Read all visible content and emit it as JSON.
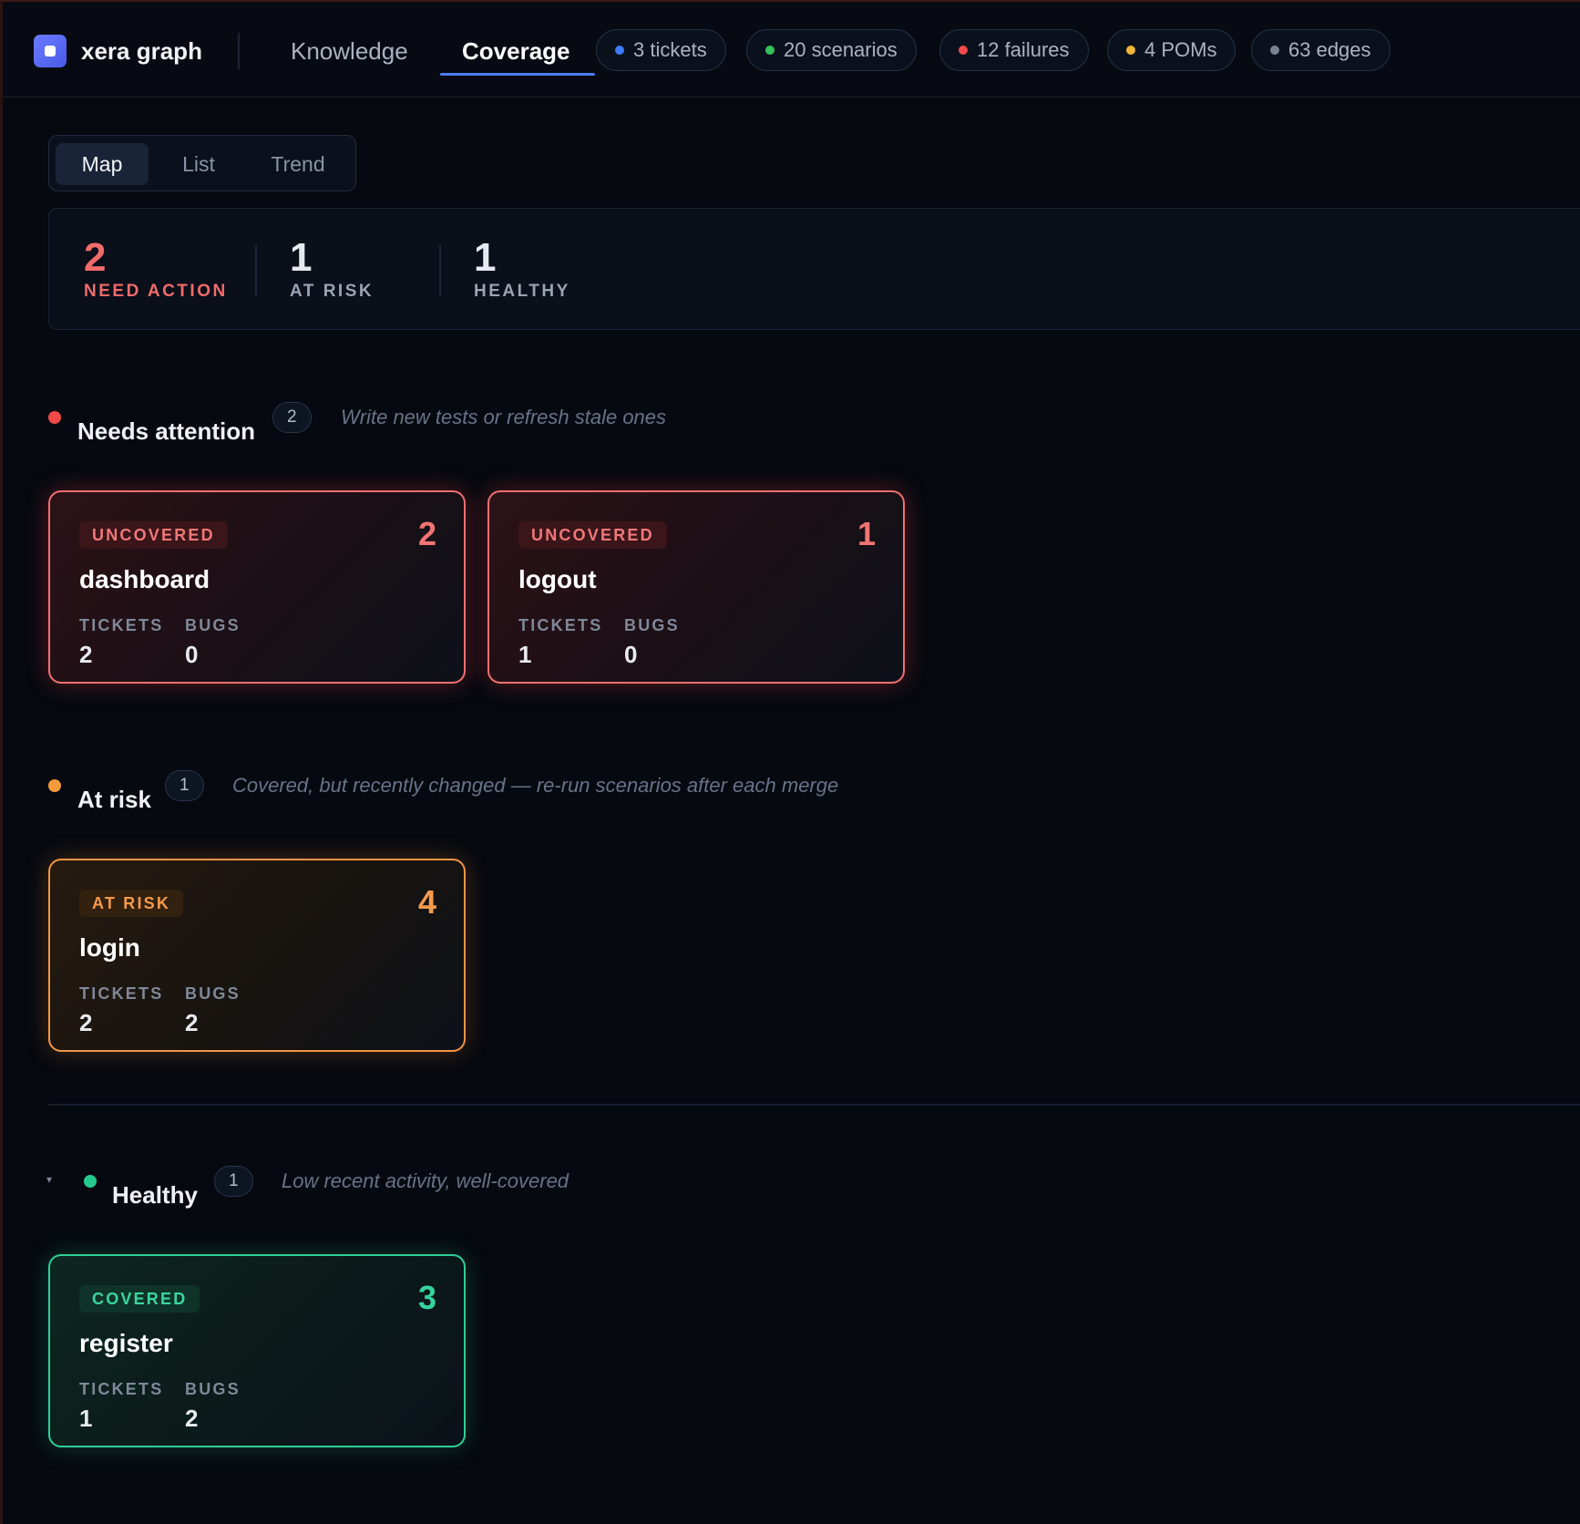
{
  "app": {
    "brand": "xera graph"
  },
  "nav": {
    "tabs": [
      {
        "label": "Knowledge"
      },
      {
        "label": "Coverage"
      }
    ]
  },
  "stats": [
    {
      "label": "3 tickets",
      "color": "#3d7bff"
    },
    {
      "label": "20 scenarios",
      "color": "#36c35a"
    },
    {
      "label": "12 failures",
      "color": "#f24a4a"
    },
    {
      "label": "4 POMs",
      "color": "#f2b53a"
    },
    {
      "label": "63 edges",
      "color": "#7a8394"
    }
  ],
  "view_switch": {
    "options": [
      "Map",
      "List",
      "Trend"
    ],
    "selected": "Map"
  },
  "summary": [
    {
      "value": "2",
      "label": "NEED ACTION",
      "color": "#f26b6b"
    },
    {
      "value": "1",
      "label": "AT RISK",
      "color": "#9aa3b2"
    },
    {
      "value": "1",
      "label": "HEALTHY",
      "color": "#9aa3b2"
    }
  ],
  "sections": [
    {
      "title": "Needs attention",
      "count": "2",
      "hint": "Write new tests or refresh stale ones",
      "color": "#f24a4a",
      "cards": [
        {
          "status": "UNCOVERED",
          "score": "2",
          "name": "dashboard",
          "tickets_label": "TICKETS",
          "tickets": "2",
          "bugs_label": "BUGS",
          "bugs": "0"
        },
        {
          "status": "UNCOVERED",
          "score": "1",
          "name": "logout",
          "tickets_label": "TICKETS",
          "tickets": "1",
          "bugs_label": "BUGS",
          "bugs": "0"
        }
      ]
    },
    {
      "title": "At risk",
      "count": "1",
      "hint": "Covered, but recently changed — re-run scenarios after each merge",
      "color": "#f59a3c",
      "cards": [
        {
          "status": "AT RISK",
          "score": "4",
          "name": "login",
          "tickets_label": "TICKETS",
          "tickets": "2",
          "bugs_label": "BUGS",
          "bugs": "2"
        }
      ]
    },
    {
      "title": "Healthy",
      "count": "1",
      "hint": "Low recent activity, well-covered",
      "color": "#26c98d",
      "cards": [
        {
          "status": "COVERED",
          "score": "3",
          "name": "register",
          "tickets_label": "TICKETS",
          "tickets": "1",
          "bugs_label": "BUGS",
          "bugs": "2"
        }
      ]
    }
  ]
}
